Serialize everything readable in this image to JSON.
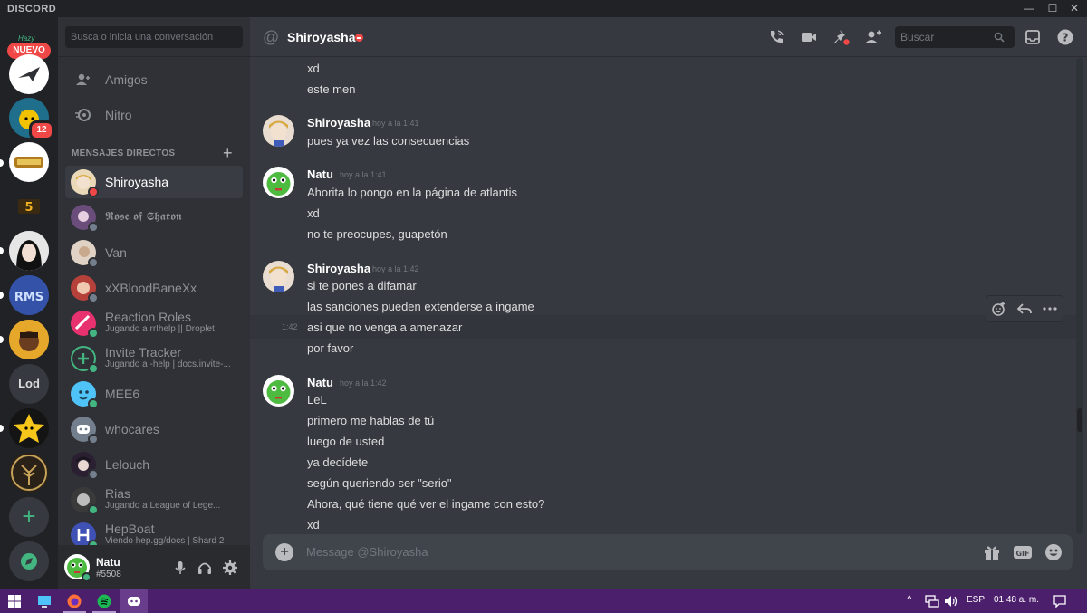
{
  "titlebar": {
    "brand": "DISCORD",
    "min": "—",
    "max": "☐",
    "close": "✕"
  },
  "rail": {
    "hazy": "Hazy",
    "nuevo": "NUEVO",
    "badge_count": "12",
    "lod_label": "Lod",
    "add_server": "+"
  },
  "sidebar": {
    "search_placeholder": "Busca o inicia una conversación",
    "nav": [
      {
        "label": "Amigos"
      },
      {
        "label": "Nitro"
      }
    ],
    "dm_header": "MENSAJES DIRECTOS",
    "dm_add": "+",
    "dms": [
      {
        "name": "Shiroyasha",
        "status": "dnd"
      },
      {
        "name": "𝕽𝖔𝖘𝖊 𝖔𝖋 𝕾𝖍𝖆𝖗𝖔𝖓",
        "status": "offline"
      },
      {
        "name": "Van",
        "status": "offline"
      },
      {
        "name": "xXBloodBaneXx",
        "status": "offline"
      },
      {
        "name": "Reaction Roles",
        "sub": "Jugando a rr!help || Droplet",
        "status": "online"
      },
      {
        "name": "Invite Tracker",
        "sub": "Jugando a -help | docs.invite-...",
        "status": "online"
      },
      {
        "name": "MEE6",
        "status": "online"
      },
      {
        "name": "whocares",
        "status": "offline"
      },
      {
        "name": "Lelouch",
        "status": "offline"
      },
      {
        "name": "Rias",
        "sub": "Jugando a League of Lege...",
        "status": "online"
      },
      {
        "name": "HepBoat",
        "sub": "Viendo hep.gg/docs | Shard 2",
        "status": "online"
      }
    ]
  },
  "user": {
    "name": "Natu",
    "tag": "#5508"
  },
  "chat": {
    "header_name": "Shiroyasha",
    "search_placeholder": "Buscar",
    "composer_placeholder": "Message @Shiroyasha",
    "hover_time": "1:42",
    "groups": [
      {
        "lines": [
          "xd",
          "este men"
        ]
      },
      {
        "author": "Shiroyasha",
        "time": "hoy a la 1:41",
        "lines": [
          "pues ya vez las consecuencias"
        ]
      },
      {
        "author": "Natu",
        "time": "hoy a la 1:41",
        "lines": [
          "Ahorita lo pongo en la página de atlantis",
          "xd",
          "no te preocupes, guapetón"
        ]
      },
      {
        "author": "Shiroyasha",
        "time": "hoy a la 1:42",
        "lines": [
          "si te pones a difamar",
          "las sanciones pueden extenderse a ingame",
          "asi que no venga a amenazar",
          "por favor"
        ]
      },
      {
        "author": "Natu",
        "time": "hoy a la 1:42",
        "lines": [
          "LeL",
          "primero me hablas de tú",
          "luego de usted",
          "ya decídete",
          "según queriendo ser \"serio\"",
          "Ahora, qué tiene qué ver el ingame con esto?",
          "xd"
        ]
      }
    ]
  },
  "taskbar": {
    "lang": "ESP",
    "clock": "01:48 a. m."
  },
  "colors": {
    "accent": "#7289da",
    "online": "#43b581",
    "dnd": "#f04747",
    "offline": "#747f8d",
    "taskbar": "#4c1f6c"
  }
}
